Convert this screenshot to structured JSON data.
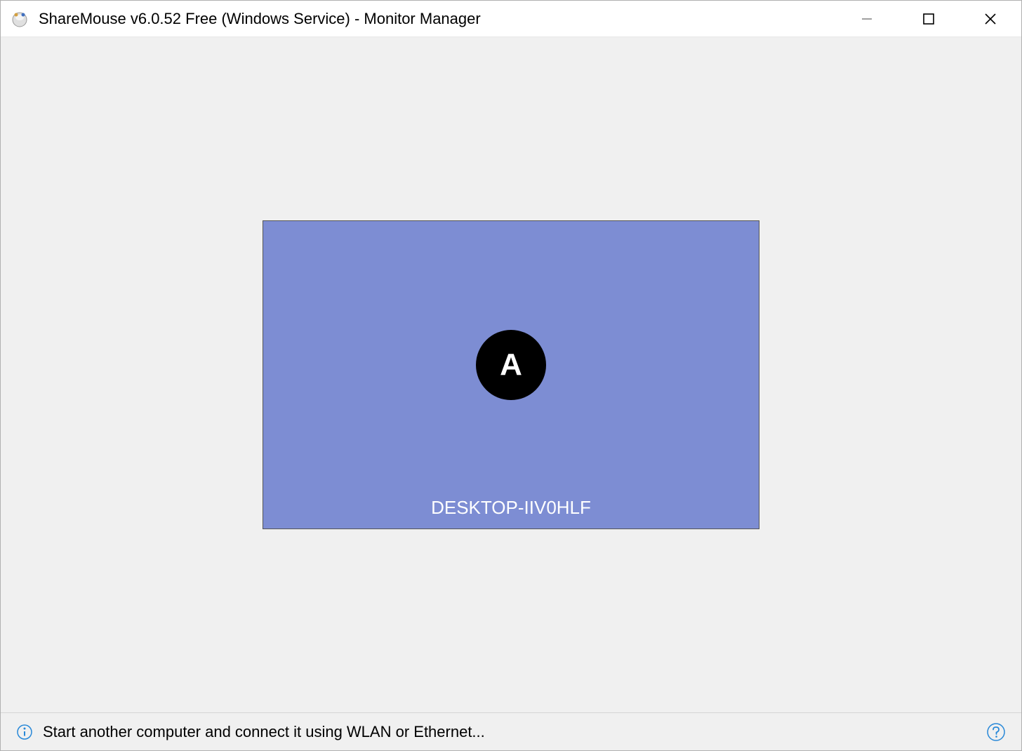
{
  "titlebar": {
    "title": "ShareMouse v6.0.52 Free (Windows Service) - Monitor Manager"
  },
  "monitor": {
    "badge_letter": "A",
    "computer_name": "DESKTOP-IIV0HLF"
  },
  "statusbar": {
    "message": "Start another computer and connect it using WLAN or Ethernet..."
  }
}
